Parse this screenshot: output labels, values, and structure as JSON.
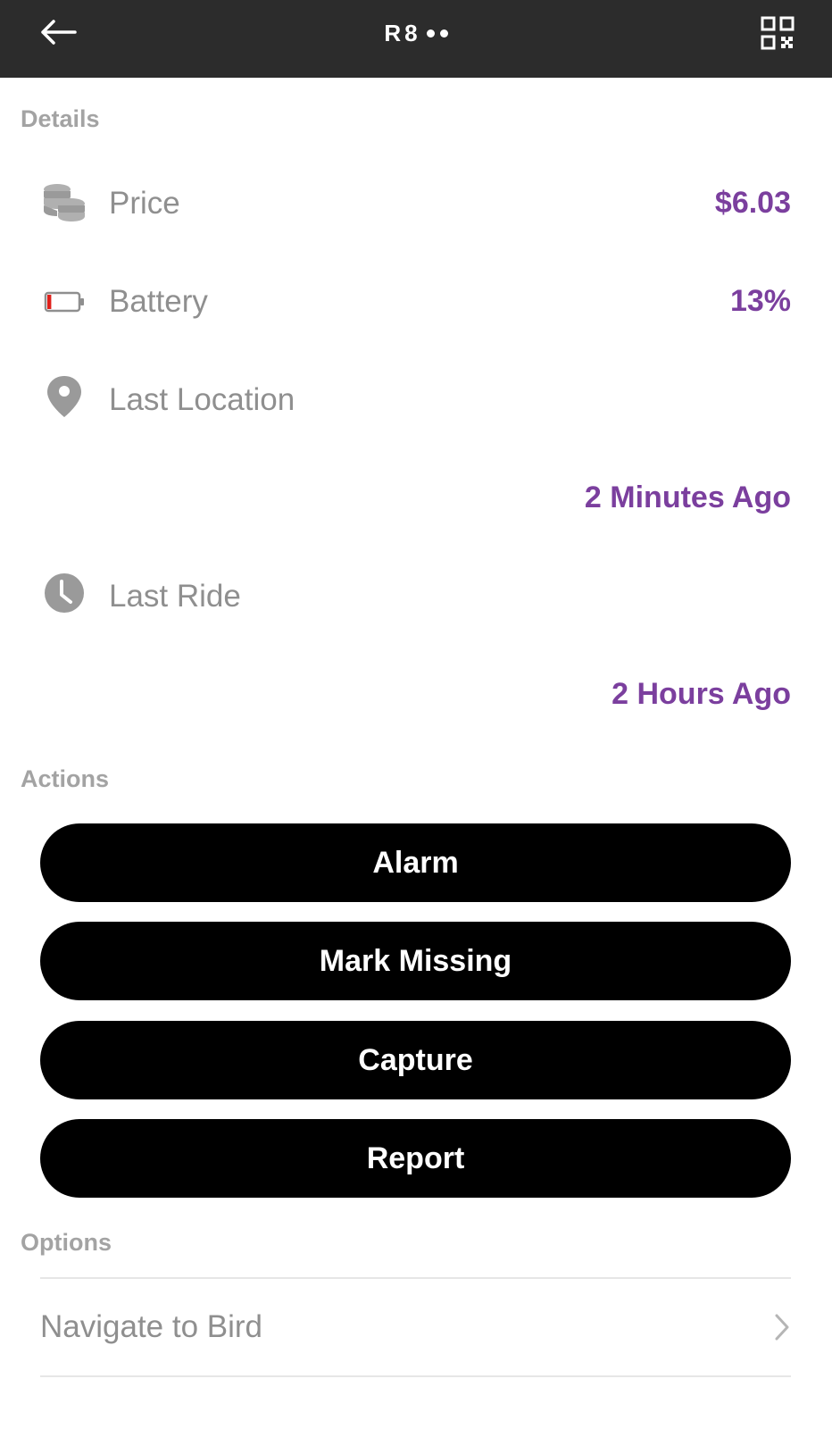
{
  "header": {
    "title": "R8",
    "back_icon": "arrow-left-icon",
    "qr_icon": "qr-code-icon"
  },
  "details": {
    "section_label": "Details",
    "price": {
      "label": "Price",
      "value": "$6.03",
      "icon": "coins-icon"
    },
    "battery": {
      "label": "Battery",
      "value": "13%",
      "icon": "battery-low-icon",
      "level": 0.13
    },
    "last_location": {
      "label": "Last Location",
      "value": "2 Minutes Ago",
      "icon": "location-pin-icon"
    },
    "last_ride": {
      "label": "Last Ride",
      "value": "2 Hours Ago",
      "icon": "clock-icon"
    }
  },
  "actions": {
    "section_label": "Actions",
    "buttons": [
      "Alarm",
      "Mark Missing",
      "Capture",
      "Report"
    ]
  },
  "options": {
    "section_label": "Options",
    "items": [
      {
        "label": "Navigate to Bird",
        "icon": "chevron-right-icon"
      }
    ]
  },
  "colors": {
    "accent": "#7b3f9e",
    "topbar": "#2c2c2c",
    "section_label": "#a3a3a3",
    "row_label": "#8f8f8f",
    "battery_low": "#e0201b"
  }
}
